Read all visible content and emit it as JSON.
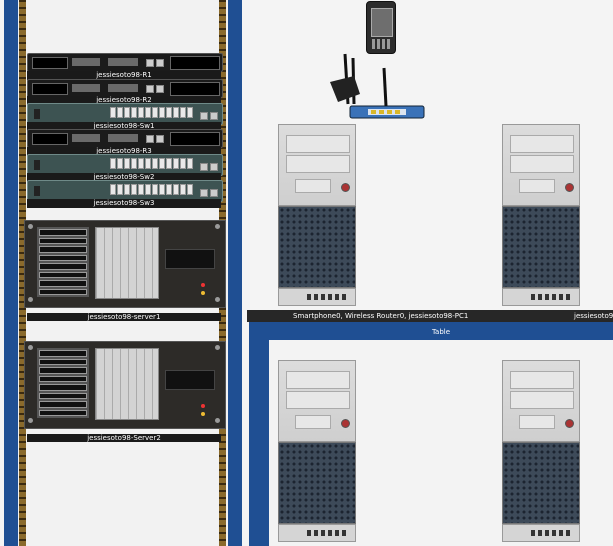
{
  "rack": {
    "devices": [
      {
        "label": "jessiesoto98-R1"
      },
      {
        "label": "jessiesoto98-R2"
      },
      {
        "label": "jessiesoto98-Sw1"
      },
      {
        "label": "jessiesoto98-R3"
      },
      {
        "label": "jessiesoto98-Sw2"
      },
      {
        "label": "jessiesoto98-Sw3"
      }
    ],
    "servers": [
      {
        "label": "jessiesoto98-server1"
      },
      {
        "label": "jessiesoto98-Server2"
      }
    ]
  },
  "desk": {
    "devices_bar_text": "Smartphone0, Wireless Router0, jessiesoto98-PC1",
    "devices_bar_text_right": "jessiesoto9",
    "table_label": "Table"
  }
}
